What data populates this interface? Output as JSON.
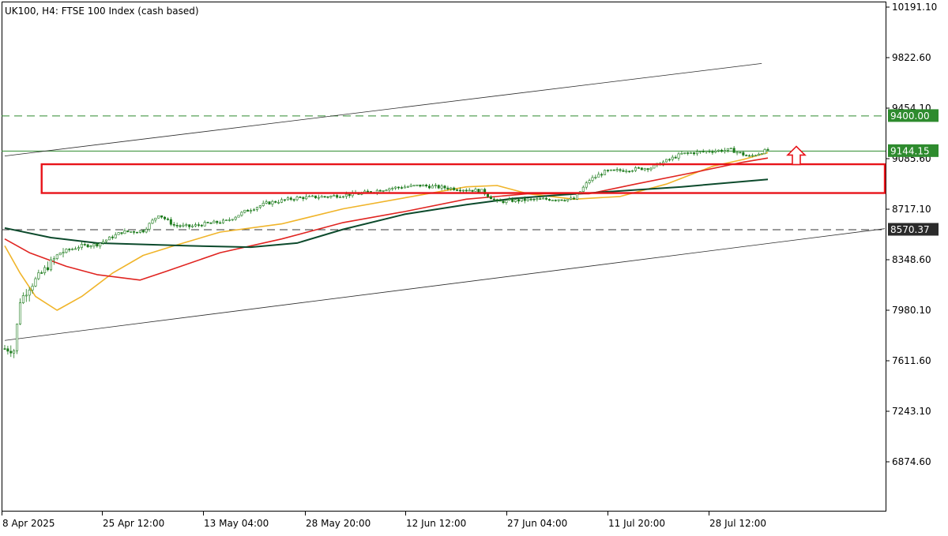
{
  "header": {
    "title": "UK100, H4:  FTSE 100 Index (cash based)"
  },
  "chart_data": {
    "type": "candlestick",
    "symbol": "UK100",
    "timeframe": "H4",
    "instrument": "FTSE 100 Index (cash based)",
    "y_axis": {
      "ticks": [
        10191.1,
        9822.6,
        9454.1,
        9085.6,
        8717.1,
        8348.6,
        7980.1,
        7611.6,
        7243.1,
        6874.6
      ],
      "tick_labels": [
        "10191.10",
        "9822.60",
        "9454.10",
        "9085.60",
        "8717.10",
        "8348.60",
        "7980.10",
        "7611.60",
        "7243.10",
        "6874.60"
      ],
      "ylim": [
        6540,
        10220
      ]
    },
    "x_axis": {
      "tick_labels": [
        "8 Apr 2025",
        "25 Apr 12:00",
        "13 May 04:00",
        "28 May 20:00",
        "12 Jun 12:00",
        "27 Jun 04:00",
        "11 Jul 20:00",
        "28 Jul 12:00"
      ]
    },
    "price_tags": [
      {
        "value": 9400.0,
        "label": "9400.00",
        "color": "#2e8b2e"
      },
      {
        "value": 9144.15,
        "label": "9144.15",
        "color": "#2e8b2e"
      },
      {
        "value": 8570.37,
        "label": "8570.37",
        "color": "#2b2b2b"
      }
    ],
    "horizontal_lines": [
      {
        "value": 9400.0,
        "style": "dashed",
        "color": "#2e8b2e"
      },
      {
        "value": 9144.15,
        "style": "solid",
        "color": "#2e8b2e"
      },
      {
        "value": 8570.37,
        "style": "dashed",
        "color": "#333333"
      }
    ],
    "channel": {
      "upper": {
        "start_bar": 0,
        "start_value": 9105,
        "end_bar": 246,
        "end_value": 9780
      },
      "lower": {
        "start_bar": 0,
        "start_value": 7760,
        "end_bar": 286,
        "end_value": 8575
      }
    },
    "support_zone": {
      "start_bar": 12,
      "end_bar": 286,
      "top": 9045,
      "bottom": 8835,
      "color": "#e8141a"
    },
    "arrow": {
      "bar": 257,
      "value": 9060,
      "direction": "up",
      "color": "#e8141a"
    },
    "moving_averages": [
      {
        "key": "ma_fast",
        "color": "#f0b429",
        "points": [
          [
            0,
            8450
          ],
          [
            5,
            8250
          ],
          [
            10,
            8080
          ],
          [
            17,
            7980
          ],
          [
            25,
            8080
          ],
          [
            35,
            8250
          ],
          [
            45,
            8380
          ],
          [
            55,
            8450
          ],
          [
            70,
            8550
          ],
          [
            90,
            8610
          ],
          [
            110,
            8720
          ],
          [
            130,
            8800
          ],
          [
            150,
            8880
          ],
          [
            160,
            8890
          ],
          [
            170,
            8830
          ],
          [
            185,
            8790
          ],
          [
            200,
            8810
          ],
          [
            215,
            8900
          ],
          [
            230,
            9030
          ],
          [
            240,
            9080
          ],
          [
            248,
            9130
          ]
        ]
      },
      {
        "key": "ma_mid",
        "color": "#e02420",
        "points": [
          [
            0,
            8500
          ],
          [
            8,
            8400
          ],
          [
            20,
            8300
          ],
          [
            30,
            8240
          ],
          [
            44,
            8200
          ],
          [
            52,
            8260
          ],
          [
            70,
            8400
          ],
          [
            90,
            8500
          ],
          [
            110,
            8620
          ],
          [
            130,
            8700
          ],
          [
            150,
            8790
          ],
          [
            170,
            8830
          ],
          [
            190,
            8830
          ],
          [
            205,
            8900
          ],
          [
            225,
            8990
          ],
          [
            240,
            9060
          ],
          [
            248,
            9090
          ]
        ]
      },
      {
        "key": "ma_slow",
        "color": "#0c4a2c",
        "points": [
          [
            0,
            8580
          ],
          [
            15,
            8510
          ],
          [
            30,
            8470
          ],
          [
            60,
            8450
          ],
          [
            80,
            8440
          ],
          [
            95,
            8470
          ],
          [
            110,
            8570
          ],
          [
            130,
            8680
          ],
          [
            150,
            8750
          ],
          [
            165,
            8795
          ],
          [
            180,
            8820
          ],
          [
            200,
            8850
          ],
          [
            220,
            8880
          ],
          [
            248,
            8935
          ]
        ]
      }
    ],
    "candles_generator": {
      "count": 249,
      "anchors": [
        [
          0,
          7700
        ],
        [
          3,
          7690
        ],
        [
          5,
          8050
        ],
        [
          8,
          8150
        ],
        [
          12,
          8250
        ],
        [
          18,
          8400
        ],
        [
          25,
          8450
        ],
        [
          30,
          8460
        ],
        [
          38,
          8550
        ],
        [
          45,
          8560
        ],
        [
          50,
          8680
        ],
        [
          55,
          8600
        ],
        [
          60,
          8590
        ],
        [
          65,
          8610
        ],
        [
          72,
          8630
        ],
        [
          78,
          8700
        ],
        [
          85,
          8760
        ],
        [
          95,
          8800
        ],
        [
          105,
          8810
        ],
        [
          115,
          8830
        ],
        [
          125,
          8870
        ],
        [
          135,
          8890
        ],
        [
          145,
          8870
        ],
        [
          155,
          8850
        ],
        [
          160,
          8770
        ],
        [
          165,
          8780
        ],
        [
          175,
          8790
        ],
        [
          185,
          8790
        ],
        [
          190,
          8930
        ],
        [
          195,
          8990
        ],
        [
          200,
          9000
        ],
        [
          210,
          9020
        ],
        [
          220,
          9120
        ],
        [
          228,
          9140
        ],
        [
          236,
          9150
        ],
        [
          242,
          9100
        ],
        [
          248,
          9150
        ]
      ]
    }
  }
}
